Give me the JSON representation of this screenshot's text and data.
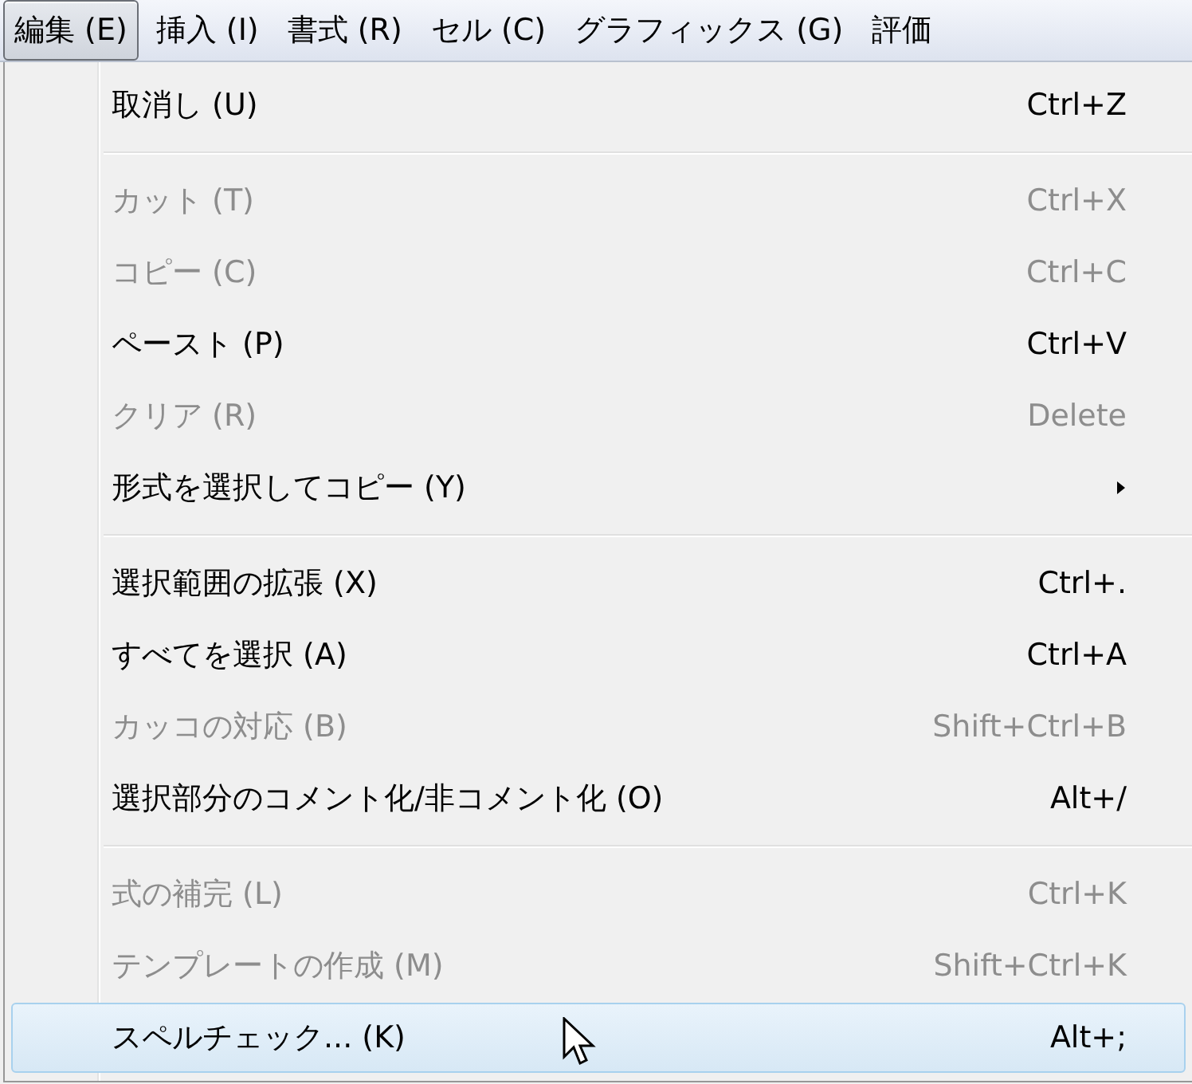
{
  "menubar": [
    {
      "label": "編集 (E)",
      "selected": true
    },
    {
      "label": "挿入 (I)",
      "selected": false
    },
    {
      "label": "書式 (R)",
      "selected": false
    },
    {
      "label": "セル (C)",
      "selected": false
    },
    {
      "label": "グラフィックス (G)",
      "selected": false
    },
    {
      "label": "評価",
      "selected": false
    }
  ],
  "menu": {
    "groups": [
      {
        "items": [
          {
            "label": "取消し (U)",
            "shortcut": "Ctrl+Z",
            "disabled": false,
            "submenu": false,
            "selected": false
          }
        ]
      },
      {
        "items": [
          {
            "label": "カット (T)",
            "shortcut": "Ctrl+X",
            "disabled": true,
            "submenu": false,
            "selected": false
          },
          {
            "label": "コピー (C)",
            "shortcut": "Ctrl+C",
            "disabled": true,
            "submenu": false,
            "selected": false
          },
          {
            "label": "ペースト (P)",
            "shortcut": "Ctrl+V",
            "disabled": false,
            "submenu": false,
            "selected": false
          },
          {
            "label": "クリア (R)",
            "shortcut": "Delete",
            "disabled": true,
            "submenu": false,
            "selected": false
          },
          {
            "label": "形式を選択してコピー (Y)",
            "disabled": false,
            "submenu": true,
            "selected": false
          }
        ]
      },
      {
        "items": [
          {
            "label": "選択範囲の拡張 (X)",
            "shortcut": "Ctrl+.",
            "disabled": false,
            "submenu": false,
            "selected": false
          },
          {
            "label": "すべてを選択 (A)",
            "shortcut": "Ctrl+A",
            "disabled": false,
            "submenu": false,
            "selected": false
          },
          {
            "label": "カッコの対応 (B)",
            "shortcut": "Shift+Ctrl+B",
            "disabled": true,
            "submenu": false,
            "selected": false
          },
          {
            "label": "選択部分のコメント化/非コメント化 (O)",
            "shortcut": "Alt+/",
            "disabled": false,
            "submenu": false,
            "selected": false
          }
        ]
      },
      {
        "items": [
          {
            "label": "式の補完 (L)",
            "shortcut": "Ctrl+K",
            "disabled": true,
            "submenu": false,
            "selected": false
          },
          {
            "label": "テンプレートの作成 (M)",
            "shortcut": "Shift+Ctrl+K",
            "disabled": true,
            "submenu": false,
            "selected": false
          },
          {
            "label": "スペルチェック... (K)",
            "shortcut": "Alt+;",
            "disabled": false,
            "submenu": false,
            "selected": true
          }
        ]
      }
    ]
  }
}
